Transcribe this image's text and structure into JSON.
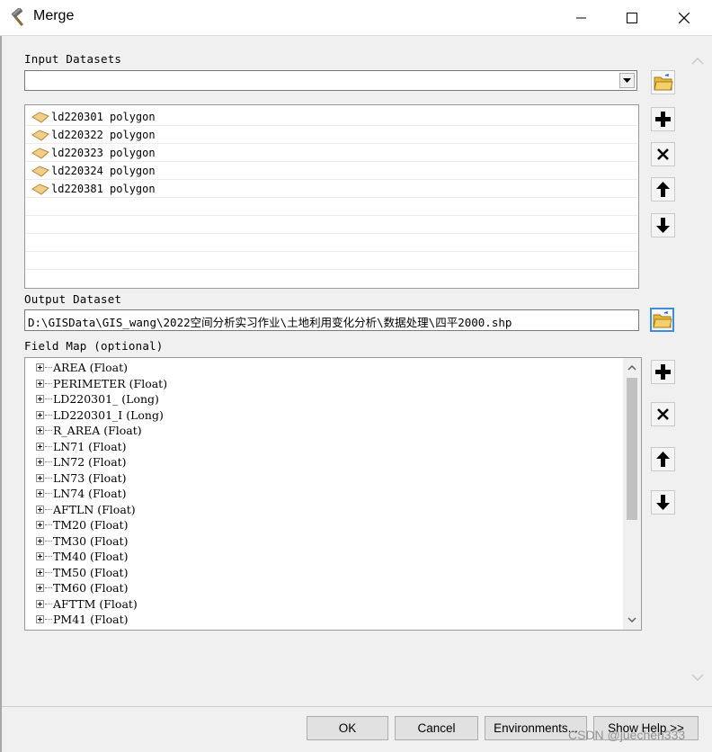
{
  "window": {
    "title": "Merge",
    "icon": "hammer-icon",
    "controls": [
      "minimize-icon",
      "maximize-icon",
      "close-icon"
    ]
  },
  "input_datasets": {
    "label": "Input Datasets",
    "combo_value": "",
    "items": [
      "ld220301 polygon",
      "ld220322 polygon",
      "ld220323 polygon",
      "ld220324 polygon",
      "ld220381 polygon"
    ],
    "item_icon": "polygon-layer-icon",
    "side_buttons": [
      "folder-open-icon",
      "add-icon",
      "remove-icon",
      "move-up-icon",
      "move-down-icon"
    ]
  },
  "output_dataset": {
    "label": "Output Dataset",
    "value": "D:\\GISData\\GIS_wang\\2022空间分析实习作业\\土地利用变化分析\\数据处理\\四平2000.shp"
  },
  "field_map": {
    "label": "Field Map (optional)",
    "fields": [
      "AREA (Float)",
      "PERIMETER (Float)",
      "LD220301_ (Long)",
      "LD220301_I (Long)",
      "R_AREA (Float)",
      "LN71 (Float)",
      "LN72 (Float)",
      "LN73 (Float)",
      "LN74 (Float)",
      "AFTLN (Float)",
      "TM20 (Float)",
      "TM30 (Float)",
      "TM40 (Float)",
      "TM50 (Float)",
      "TM60 (Float)",
      "AFTTM (Float)",
      "PM41 (Float)"
    ],
    "side_buttons": [
      "add-icon",
      "remove-icon",
      "move-up-icon",
      "move-down-icon"
    ]
  },
  "buttons": {
    "ok": "OK",
    "cancel": "Cancel",
    "environments": "Environments...",
    "show_help": "Show Help >>"
  },
  "watermark": "CSDN @juechen333",
  "colors": {
    "accent_border": "#3c8ce0",
    "folder_yellow": "#f3c54a",
    "polygon_tan": "#e8c07a"
  }
}
